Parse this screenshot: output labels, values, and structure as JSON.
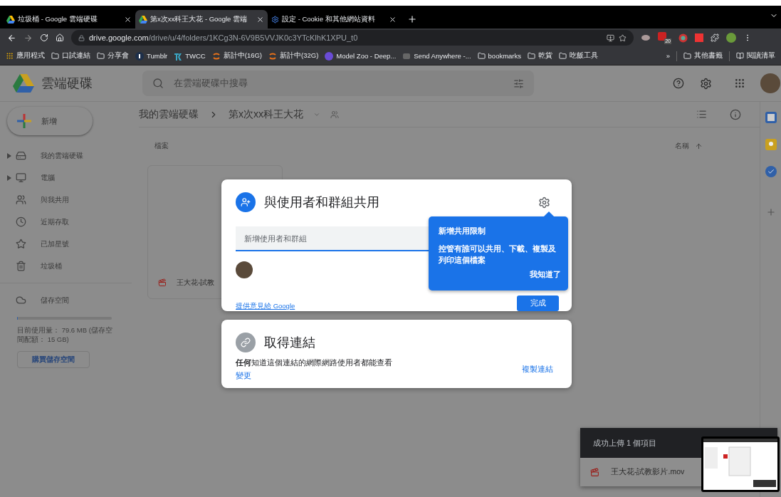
{
  "browser": {
    "tabs": [
      {
        "title": "垃圾桶 - Google 雲端硬碟",
        "selected": false
      },
      {
        "title": "第x次xx科王大花 - Google 雲端",
        "selected": true
      },
      {
        "title": "設定 - Cookie 和其他網站資料",
        "selected": false
      }
    ],
    "url_host": "drive.google.com",
    "url_path": "/drive/u/4/folders/1KCg3N-6V9B5VVJK0c3YTcKlhK1XPU_t0",
    "extension_badge": "20",
    "bookmarks": [
      {
        "label": "應用程式",
        "kind": "apps"
      },
      {
        "label": "口試連結",
        "kind": "folder"
      },
      {
        "label": "分享會",
        "kind": "folder"
      },
      {
        "label": "Tumblr",
        "kind": "tumblr"
      },
      {
        "label": "TWCC",
        "kind": "twcc"
      },
      {
        "label": "新計中(16G)",
        "kind": "ring"
      },
      {
        "label": "新計中(32G)",
        "kind": "ring"
      },
      {
        "label": "Model Zoo - Deep...",
        "kind": "model"
      },
      {
        "label": "Send Anywhere -...",
        "kind": "send"
      },
      {
        "label": "bookmarks",
        "kind": "folder"
      },
      {
        "label": "乾貨",
        "kind": "folder"
      },
      {
        "label": "吃飯工具",
        "kind": "folder"
      }
    ],
    "overflow": "»",
    "bookmarks_right": [
      {
        "label": "其他書籤",
        "kind": "folder"
      },
      {
        "label": "閱讀清單",
        "kind": "list"
      }
    ]
  },
  "drive": {
    "logo_text": "雲端硬碟",
    "search_placeholder": "在雲端硬碟中搜尋",
    "new_button": "新增",
    "nav": [
      {
        "label": "我的雲端硬碟",
        "kind": "drive",
        "expandable": true
      },
      {
        "label": "電腦",
        "kind": "computer",
        "expandable": true
      },
      {
        "label": "與我共用",
        "kind": "shared",
        "expandable": false
      },
      {
        "label": "近期存取",
        "kind": "recent",
        "expandable": false
      },
      {
        "label": "已加星號",
        "kind": "starred",
        "expandable": false
      },
      {
        "label": "垃圾桶",
        "kind": "trash",
        "expandable": false
      }
    ],
    "storage": {
      "label": "儲存空間",
      "level": 0.01,
      "usage": "目前使用量： 79.6 MB (儲存空間配額： 15 GB)",
      "buy_button": "購買儲存空間"
    },
    "breadcrumb": [
      "我的雲端硬碟",
      "第x次xx科王大花"
    ],
    "section_label": "檔案",
    "sort_label": "名稱",
    "file_name": "王大花-試教"
  },
  "share_dialog": {
    "title": "與使用者和群組共用",
    "input_placeholder": "新增使用者和群組",
    "feedback_link": "提供意見給 Google",
    "done_button": "完成",
    "tip": {
      "title": "新增共用限制",
      "body": "控管有誰可以共用、下載、複製及列印這個檔案",
      "dismiss": "我知道了"
    }
  },
  "link_dialog": {
    "title": "取得連結",
    "description": "**任何**知道這個連結的網際網路使用者都能查看",
    "change_link": "變更",
    "copy_link": "複製連結"
  },
  "upload_toast": {
    "title": "成功上傳 1 個項目",
    "file": "王大花-試教影片.mov"
  }
}
